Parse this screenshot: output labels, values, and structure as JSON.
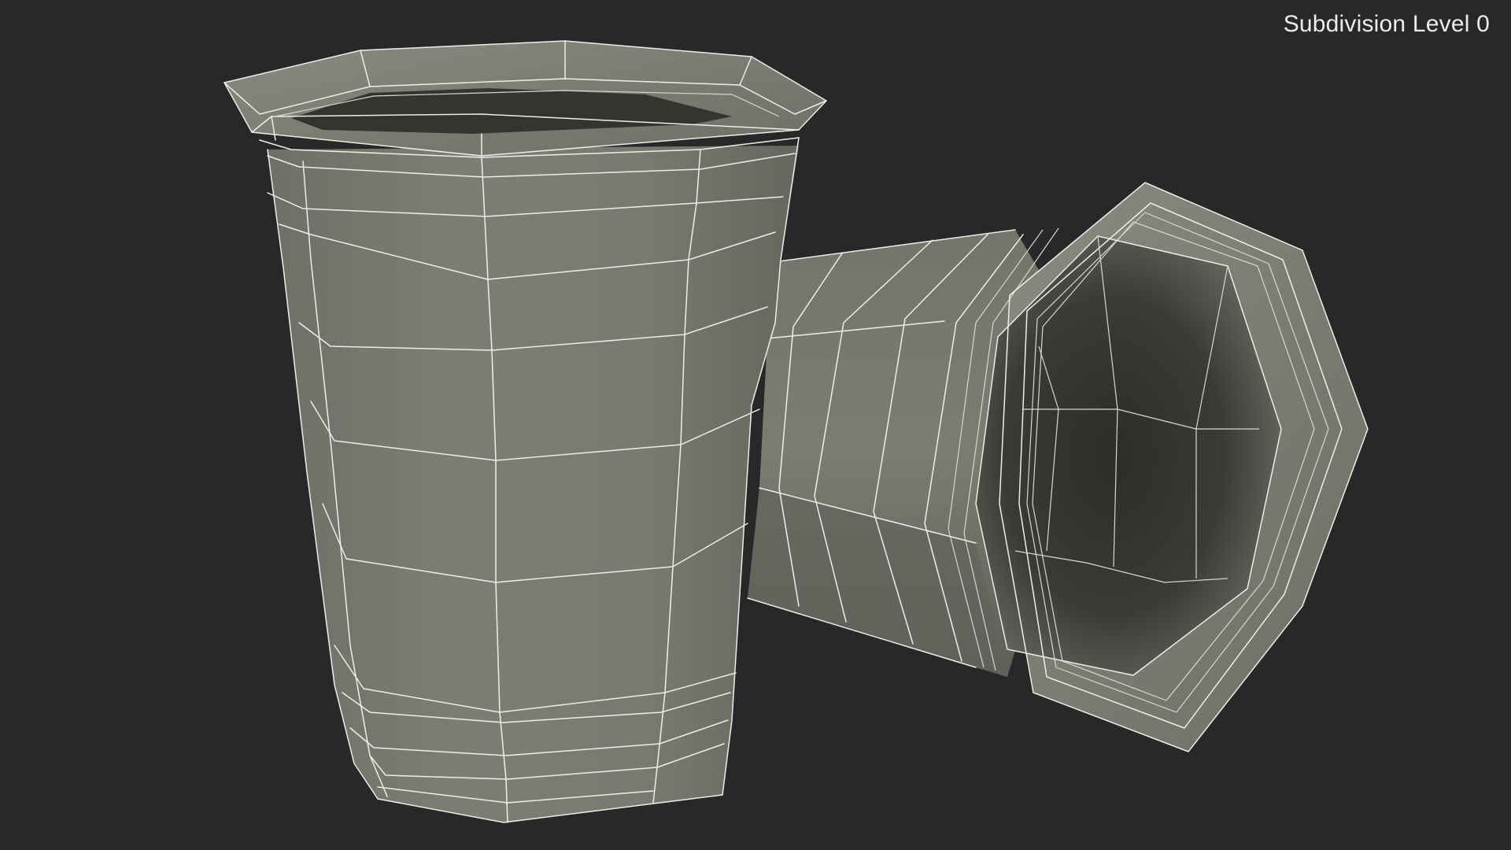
{
  "viewport": {
    "subdivision_label": "Subdivision Level 0",
    "background_color": "#282828",
    "mesh_color": "#7a7a70",
    "wireframe_color": "#ededea"
  }
}
